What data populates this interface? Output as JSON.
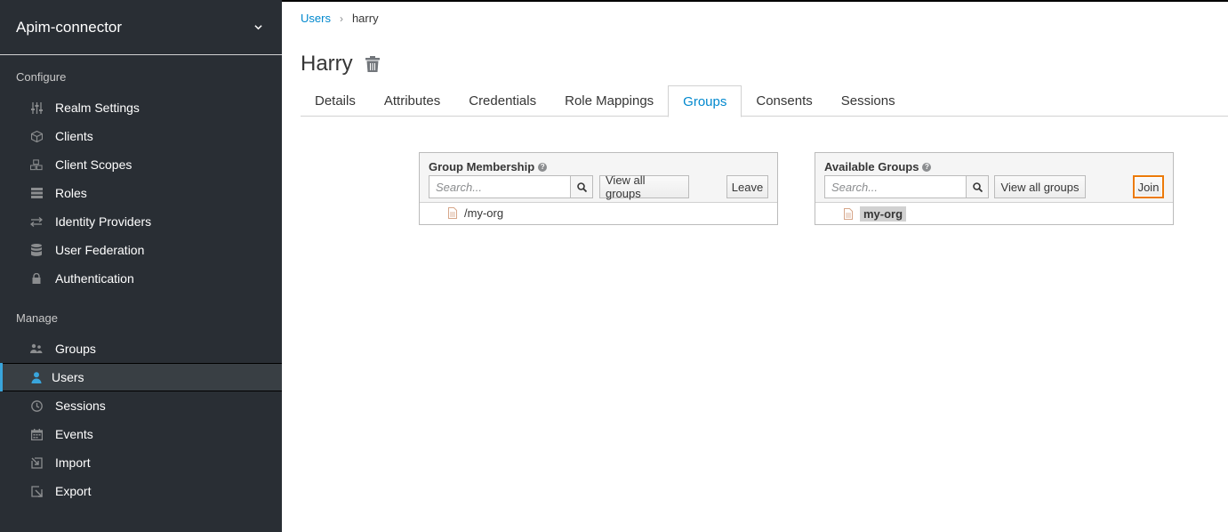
{
  "sidebar": {
    "realm_name": "Apim-connector",
    "configure_title": "Configure",
    "manage_title": "Manage",
    "configure_items": [
      {
        "label": "Realm Settings",
        "icon": "sliders-icon"
      },
      {
        "label": "Clients",
        "icon": "cube-icon"
      },
      {
        "label": "Client Scopes",
        "icon": "cubes-icon"
      },
      {
        "label": "Roles",
        "icon": "list-icon"
      },
      {
        "label": "Identity Providers",
        "icon": "exchange-icon"
      },
      {
        "label": "User Federation",
        "icon": "database-icon"
      },
      {
        "label": "Authentication",
        "icon": "lock-icon"
      }
    ],
    "manage_items": [
      {
        "label": "Groups",
        "icon": "users-icon"
      },
      {
        "label": "Users",
        "icon": "user-icon",
        "active": true
      },
      {
        "label": "Sessions",
        "icon": "clock-icon"
      },
      {
        "label": "Events",
        "icon": "calendar-icon"
      },
      {
        "label": "Import",
        "icon": "import-icon"
      },
      {
        "label": "Export",
        "icon": "export-icon"
      }
    ]
  },
  "breadcrumb": {
    "parent": "Users",
    "current": "harry"
  },
  "page": {
    "title": "Harry"
  },
  "tabs": [
    "Details",
    "Attributes",
    "Credentials",
    "Role Mappings",
    "Groups",
    "Consents",
    "Sessions"
  ],
  "active_tab": "Groups",
  "membership": {
    "title": "Group Membership",
    "search_placeholder": "Search...",
    "view_all": "View all groups",
    "action": "Leave",
    "items": [
      "/my-org"
    ]
  },
  "available": {
    "title": "Available Groups",
    "search_placeholder": "Search...",
    "view_all": "View all groups",
    "action": "Join",
    "items": [
      "my-org"
    ]
  },
  "colors": {
    "sidebar_bg": "#292e34",
    "accent": "#0088ce",
    "active_bar": "#39a5dc",
    "focus": "#ec7a08"
  }
}
